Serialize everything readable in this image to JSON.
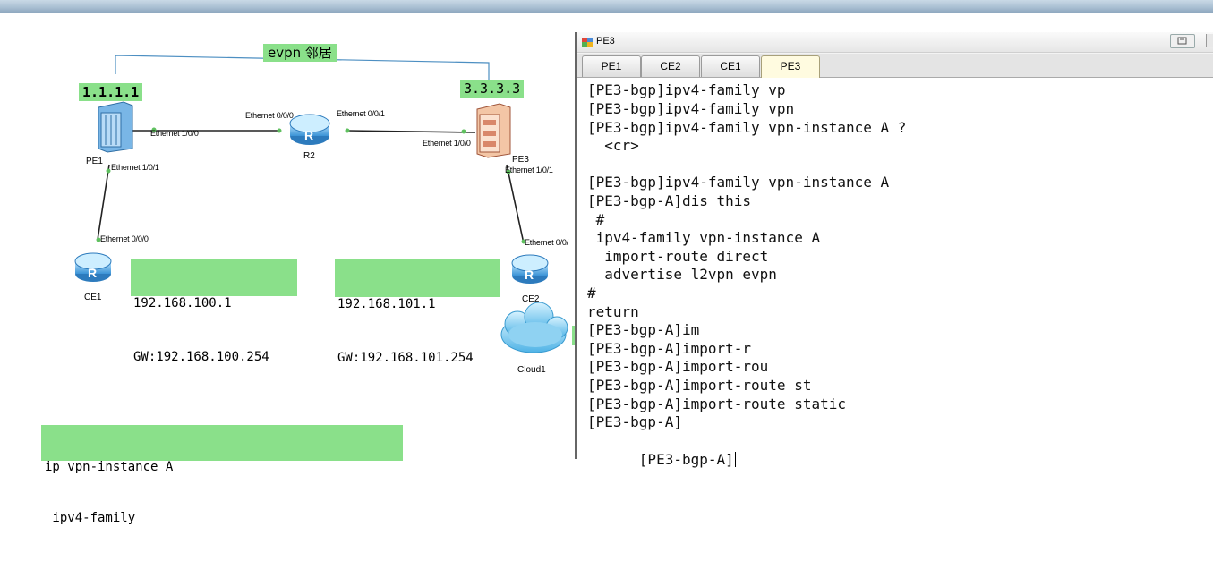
{
  "topology": {
    "evpn_label": "evpn 邻居",
    "devices": {
      "pe1": {
        "name": "PE1",
        "loopback": "1.1.1.1"
      },
      "r2": {
        "name": "R2"
      },
      "pe3": {
        "name": "PE3",
        "loopback": "3.3.3.3"
      },
      "ce1": {
        "name": "CE1"
      },
      "ce2": {
        "name": "CE2"
      },
      "cloud1": {
        "name": "Cloud1"
      }
    },
    "interfaces": {
      "pe1_e100": "Ethernet 1/0/0",
      "pe1_e101": "Ethernet 1/0/1",
      "r2_e000": "Ethernet 0/0/0",
      "r2_e001": "Ethernet 0/0/1",
      "pe3_e100": "Ethernet 1/0/0",
      "pe3_e101": "Ethernet 1/0/1",
      "ce1_e000": "Ethernet 0/0/0",
      "ce2_e000": "Ethernet 0/0/"
    },
    "host_labels": {
      "ce1_block": [
        "192.168.100.1",
        "GW:192.168.100.254"
      ],
      "ce2_block": [
        "192.168.101.1",
        "GW:192.168.101.254"
      ]
    },
    "config_note": [
      "ip vpn-instance A",
      " ipv4-family"
    ]
  },
  "window": {
    "title": "PE3",
    "tabs": [
      {
        "label": "PE1",
        "active": false
      },
      {
        "label": "CE2",
        "active": false
      },
      {
        "label": "CE1",
        "active": false
      },
      {
        "label": "PE3",
        "active": true
      }
    ],
    "terminal_lines": [
      "[PE3-bgp]ipv4-family vp",
      "[PE3-bgp]ipv4-family vpn",
      "[PE3-bgp]ipv4-family vpn-instance A ?",
      "  <cr>",
      "",
      "[PE3-bgp]ipv4-family vpn-instance A",
      "[PE3-bgp-A]dis this",
      " #",
      " ipv4-family vpn-instance A",
      "  import-route direct",
      "  advertise l2vpn evpn",
      "#",
      "return",
      "[PE3-bgp-A]im",
      "[PE3-bgp-A]import-r",
      "[PE3-bgp-A]import-rou",
      "[PE3-bgp-A]import-route st",
      "[PE3-bgp-A]import-route static",
      "[PE3-bgp-A]",
      "[PE3-bgp-A]"
    ]
  },
  "colors": {
    "label_green": "#8ae08a",
    "link_blue": "#4d8fc2",
    "port_green": "#5fc05f"
  }
}
